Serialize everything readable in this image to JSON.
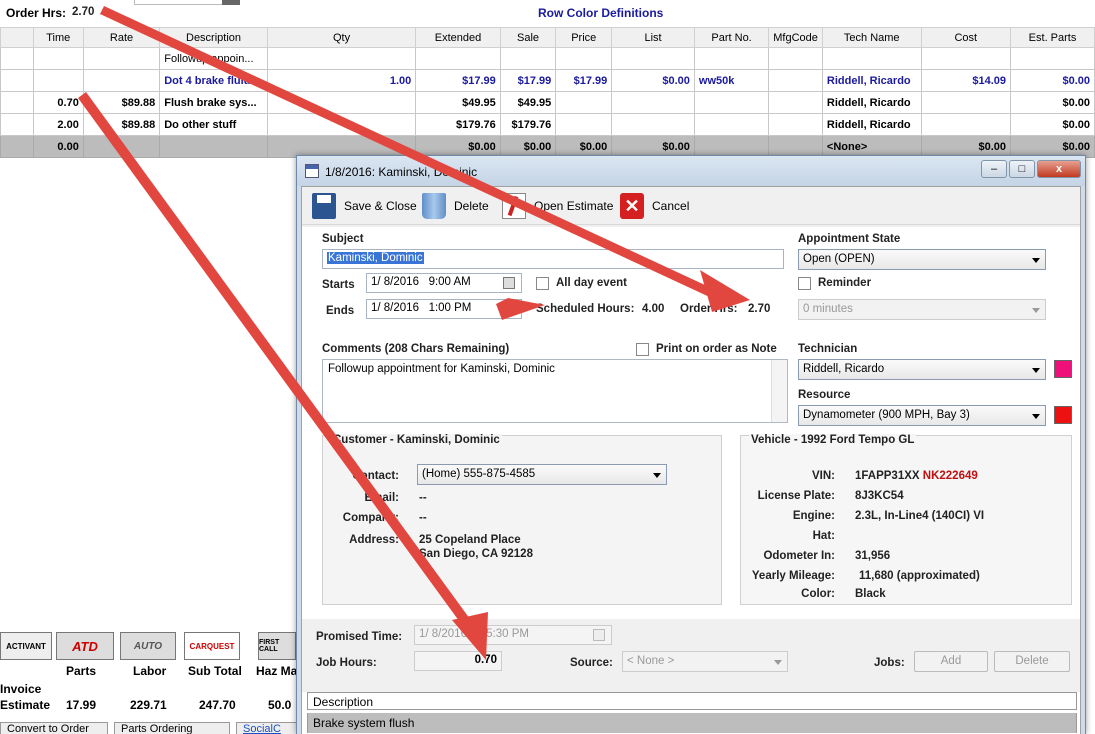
{
  "top": {
    "order_hrs_label": "Order Hrs:",
    "order_hrs_value": "2.70",
    "row_color_link": "Row Color Definitions"
  },
  "grid": {
    "columns": [
      "Time",
      "Rate",
      "Description",
      "Qty",
      "Extended",
      "Sale",
      "Price",
      "List",
      "Part No.",
      "MfgCode",
      "Tech Name",
      "Cost",
      "Est. Parts"
    ],
    "rows": [
      [
        "",
        "",
        "Followup appoin...",
        "",
        "",
        "",
        "",
        "",
        "",
        "",
        "",
        "",
        ""
      ],
      [
        "",
        "",
        "Dot 4 brake fluid",
        "1.00",
        "$17.99",
        "$17.99",
        "$17.99",
        "$0.00",
        "ww50k",
        "",
        "Riddell, Ricardo",
        "$14.09",
        "$0.00"
      ],
      [
        "0.70",
        "$89.88",
        "Flush brake sys...",
        "",
        "$49.95",
        "$49.95",
        "",
        "",
        "",
        "",
        "Riddell, Ricardo",
        "",
        "$0.00"
      ],
      [
        "2.00",
        "$89.88",
        "Do other stuff",
        "",
        "$179.76",
        "$179.76",
        "",
        "",
        "",
        "",
        "Riddell, Ricardo",
        "",
        "$0.00"
      ]
    ],
    "totals": [
      "0.00",
      "",
      "",
      "",
      "$0.00",
      "$0.00",
      "$0.00",
      "$0.00",
      "",
      "",
      "<None>",
      "$0.00",
      "$0.00"
    ]
  },
  "bottom_left": {
    "vendors": [
      "ACTIVANT",
      "ATD",
      "AUTO",
      "CARQUEST",
      "FIRST CALL"
    ],
    "col_labels": [
      "Parts",
      "Labor",
      "Sub Total",
      "Haz Ma"
    ],
    "row_labels": [
      "Invoice",
      "Estimate"
    ],
    "estimate_values": [
      "17.99",
      "229.71",
      "247.70",
      "50.0"
    ],
    "buttons": [
      "Convert to Order",
      "Parts Ordering",
      "SocialC"
    ]
  },
  "dialog": {
    "title": "1/8/2016: Kaminski, Dominic",
    "window_controls": [
      "–",
      "□",
      "x"
    ],
    "toolbar": {
      "save_close": "Save & Close",
      "delete": "Delete",
      "open_estimate": "Open Estimate",
      "cancel": "Cancel"
    },
    "subject": {
      "label": "Subject",
      "value": "Kaminski, Dominic"
    },
    "appointment_state": {
      "label": "Appointment State",
      "value": "Open (OPEN)"
    },
    "starts": {
      "label": "Starts",
      "date": "1/  8/2016",
      "time": "9:00 AM"
    },
    "ends": {
      "label": "Ends",
      "date": "1/  8/2016",
      "time": "1:00 PM"
    },
    "all_day": {
      "label": "All day event",
      "checked": false
    },
    "reminder": {
      "label": "Reminder",
      "checked": false,
      "value": "0 minutes"
    },
    "scheduled_hours": {
      "label": "Scheduled Hours:",
      "value": "4.00"
    },
    "order_hrs": {
      "label": "Order Hrs:",
      "value": "2.70"
    },
    "comments": {
      "label": "Comments (208 Chars Remaining)",
      "text": "Followup appointment for Kaminski, Dominic"
    },
    "print_on_order": {
      "label": "Print on order as Note",
      "checked": false
    },
    "technician": {
      "label": "Technician",
      "value": "Riddell, Ricardo",
      "color": "#f0107a"
    },
    "resource": {
      "label": "Resource",
      "value": "Dynamometer (900 MPH, Bay 3)",
      "color": "#ee1111"
    },
    "customer": {
      "title": "Customer - Kaminski, Dominic",
      "contact_label": "Contact:",
      "contact_value": "(Home)  555-875-4585",
      "email_label": "Email:",
      "email_value": "--",
      "company_label": "Company:",
      "company_value": "--",
      "address_label": "Address:",
      "address_line1": "25 Copeland Place",
      "address_line2": "San Diego, CA 92128"
    },
    "vehicle": {
      "title": "Vehicle - 1992 Ford Tempo GL",
      "vin_label": "VIN:",
      "vin_main": "1FAPP31XX",
      "vin_red": "NK222649",
      "plate_label": "License Plate:",
      "plate_value": "8J3KC54",
      "engine_label": "Engine:",
      "engine_value": "2.3L, In-Line4 (140CI) VI",
      "hat_label": "Hat:",
      "hat_value": "",
      "odometer_label": "Odometer In:",
      "odometer_value": "31,956",
      "mileage_label": "Yearly Mileage:",
      "mileage_value": "11,680 (approximated)",
      "color_label": "Color:",
      "color_value": "Black"
    },
    "promised_time": {
      "label": "Promised Time:",
      "date": "1/  8/2016",
      "time": "5:30 PM"
    },
    "job_hours": {
      "label": "Job Hours:",
      "value": "0.70"
    },
    "source": {
      "label": "Source:",
      "value": "< None >"
    },
    "jobs": {
      "label": "Jobs:",
      "add": "Add",
      "delete": "Delete"
    },
    "description": {
      "header": "Description",
      "row": "Brake system flush"
    }
  },
  "annotation_color": "#e2473f"
}
